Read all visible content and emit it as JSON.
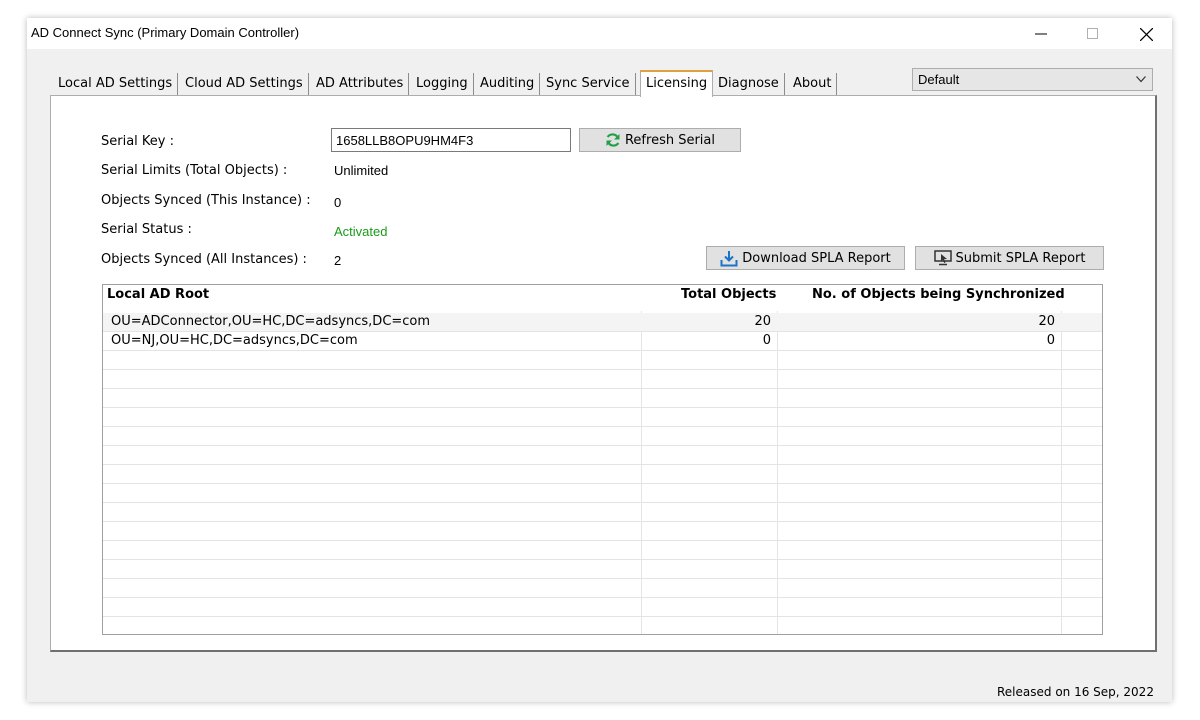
{
  "window": {
    "title": "AD Connect Sync (Primary Domain Controller)"
  },
  "tabs": [
    {
      "label": "Local AD Settings"
    },
    {
      "label": "Cloud AD Settings"
    },
    {
      "label": "AD Attributes"
    },
    {
      "label": "Logging"
    },
    {
      "label": "Auditing"
    },
    {
      "label": "Sync Service"
    },
    {
      "label": "Licensing",
      "active": true
    },
    {
      "label": "Diagnose"
    },
    {
      "label": "About"
    }
  ],
  "profile_select": {
    "value": "Default"
  },
  "licensing": {
    "serial_key_label": "Serial Key :",
    "serial_key_value": "1658LLB8OPU9HM4F3",
    "refresh_button": "Refresh Serial",
    "serial_limits_label": "Serial Limits (Total Objects) :",
    "serial_limits_value": "Unlimited",
    "objects_synced_instance_label": "Objects Synced (This Instance) :",
    "objects_synced_instance_value": "0",
    "serial_status_label": "Serial Status :",
    "serial_status_value": "Activated",
    "objects_synced_all_label": "Objects Synced (All Instances) :",
    "objects_synced_all_value": "2",
    "download_button": "Download SPLA Report",
    "submit_button": "Submit SPLA Report"
  },
  "table": {
    "columns": [
      "Local AD Root",
      "Total Objects",
      "No. of Objects being Synchronized"
    ],
    "rows": [
      [
        "OU=ADConnector,OU=HC,DC=adsyncs,DC=com",
        "20",
        "20"
      ],
      [
        "OU=NJ,OU=HC,DC=adsyncs,DC=com",
        "0",
        "0"
      ]
    ]
  },
  "footer": {
    "release_text": "Released on 16 Sep, 2022"
  },
  "colors": {
    "status_active": "#1a9a1a",
    "refresh_icon": "#22a045",
    "download_icon": "#1a73c8"
  }
}
